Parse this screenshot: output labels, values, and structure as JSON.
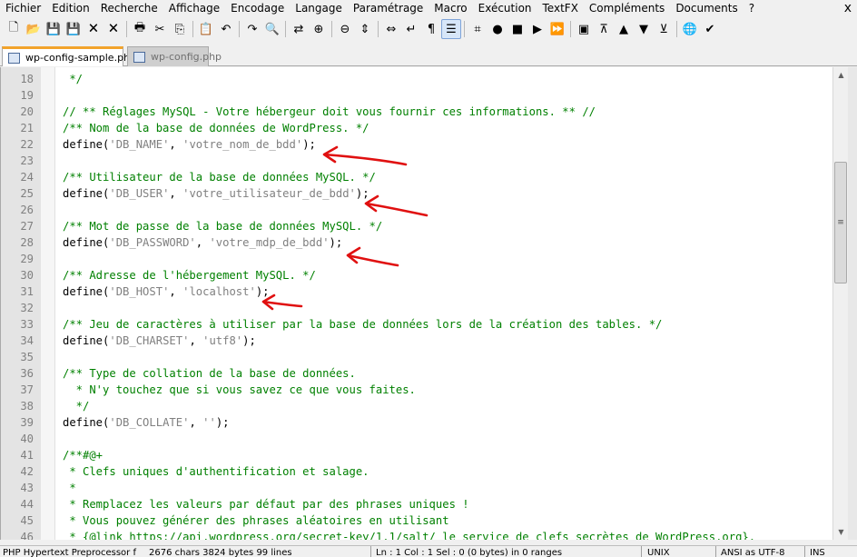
{
  "menu": [
    "Fichier",
    "Edition",
    "Recherche",
    "Affichage",
    "Encodage",
    "Langage",
    "Paramétrage",
    "Macro",
    "Exécution",
    "TextFX",
    "Compléments",
    "Documents",
    "?"
  ],
  "close_glyph": "x",
  "toolbar": [
    "new-file",
    "open-folder",
    "save",
    "save-all",
    "close",
    "close-all",
    "print",
    "cut",
    "copy",
    "paste",
    "undo",
    "redo",
    "find",
    "replace",
    "zoom-in",
    "zoom-out",
    "sync-vertical",
    "sync-horizontal",
    "word-wrap",
    "show-all-chars",
    "indent-guide",
    "user-defined-language",
    "record-macro",
    "stop-record",
    "play-macro",
    "run-macro-multiple",
    "save-macro",
    "fold-all",
    "up",
    "down",
    "unfold-all",
    "launch-browser",
    "spell-check"
  ],
  "tabs": [
    {
      "label": "wp-config-sample.php",
      "active": true
    },
    {
      "label": "wp-config.php",
      "active": false
    }
  ],
  "code_lines": [
    {
      "n": "18",
      "t": " */",
      "k": "c"
    },
    {
      "n": "19",
      "t": "",
      "k": "c"
    },
    {
      "n": "20",
      "t": "// ** Réglages MySQL - Votre hébergeur doit vous fournir ces informations. ** //",
      "k": "c"
    },
    {
      "n": "21",
      "t": "/** Nom de la base de données de WordPress. */",
      "k": "c"
    },
    {
      "n": "22",
      "p": [
        "define(",
        "'DB_NAME'",
        ", ",
        "'votre_nom_de_bdd'",
        ");"
      ]
    },
    {
      "n": "23",
      "t": "",
      "k": "c"
    },
    {
      "n": "24",
      "t": "/** Utilisateur de la base de données MySQL. */",
      "k": "c"
    },
    {
      "n": "25",
      "p": [
        "define(",
        "'DB_USER'",
        ", ",
        "'votre_utilisateur_de_bdd'",
        ");"
      ]
    },
    {
      "n": "26",
      "t": "",
      "k": "c"
    },
    {
      "n": "27",
      "t": "/** Mot de passe de la base de données MySQL. */",
      "k": "c"
    },
    {
      "n": "28",
      "p": [
        "define(",
        "'DB_PASSWORD'",
        ", ",
        "'votre_mdp_de_bdd'",
        ");"
      ]
    },
    {
      "n": "29",
      "t": "",
      "k": "c"
    },
    {
      "n": "30",
      "t": "/** Adresse de l'hébergement MySQL. */",
      "k": "c"
    },
    {
      "n": "31",
      "p": [
        "define(",
        "'DB_HOST'",
        ", ",
        "'localhost'",
        ");"
      ]
    },
    {
      "n": "32",
      "t": "",
      "k": "c"
    },
    {
      "n": "33",
      "t": "/** Jeu de caractères à utiliser par la base de données lors de la création des tables. */",
      "k": "c"
    },
    {
      "n": "34",
      "p": [
        "define(",
        "'DB_CHARSET'",
        ", ",
        "'utf8'",
        ");"
      ]
    },
    {
      "n": "35",
      "t": "",
      "k": "c"
    },
    {
      "n": "36",
      "t": "/** Type de collation de la base de données.",
      "k": "c"
    },
    {
      "n": "37",
      "t": "  * N'y touchez que si vous savez ce que vous faites.",
      "k": "c"
    },
    {
      "n": "38",
      "t": "  */",
      "k": "c"
    },
    {
      "n": "39",
      "p": [
        "define(",
        "'DB_COLLATE'",
        ", ",
        "''",
        ");"
      ]
    },
    {
      "n": "40",
      "t": "",
      "k": "c"
    },
    {
      "n": "41",
      "t": "/**#@+",
      "k": "c"
    },
    {
      "n": "42",
      "t": " * Clefs uniques d'authentification et salage.",
      "k": "c"
    },
    {
      "n": "43",
      "t": " *",
      "k": "c"
    },
    {
      "n": "44",
      "t": " * Remplacez les valeurs par défaut par des phrases uniques !",
      "k": "c"
    },
    {
      "n": "45",
      "t": " * Vous pouvez générer des phrases aléatoires en utilisant",
      "k": "c"
    },
    {
      "n": "46",
      "t": " * {@link https://api.wordpress.org/secret-key/1.1/salt/ le service de clefs secrètes de WordPress.org}.",
      "k": "c"
    }
  ],
  "status": {
    "lang": "PHP Hypertext Preprocessor f",
    "length": "2676 chars   3824 bytes   99 lines",
    "pos": "Ln : 1    Col : 1    Sel : 0 (0 bytes) in 0 ranges",
    "eol": "UNIX",
    "enc": "ANSI as UTF-8",
    "mode": "INS"
  },
  "colors": {
    "comment": "#008000",
    "string": "#808080",
    "arrow": "#e01010",
    "tab_accent": "#f2a32b"
  }
}
